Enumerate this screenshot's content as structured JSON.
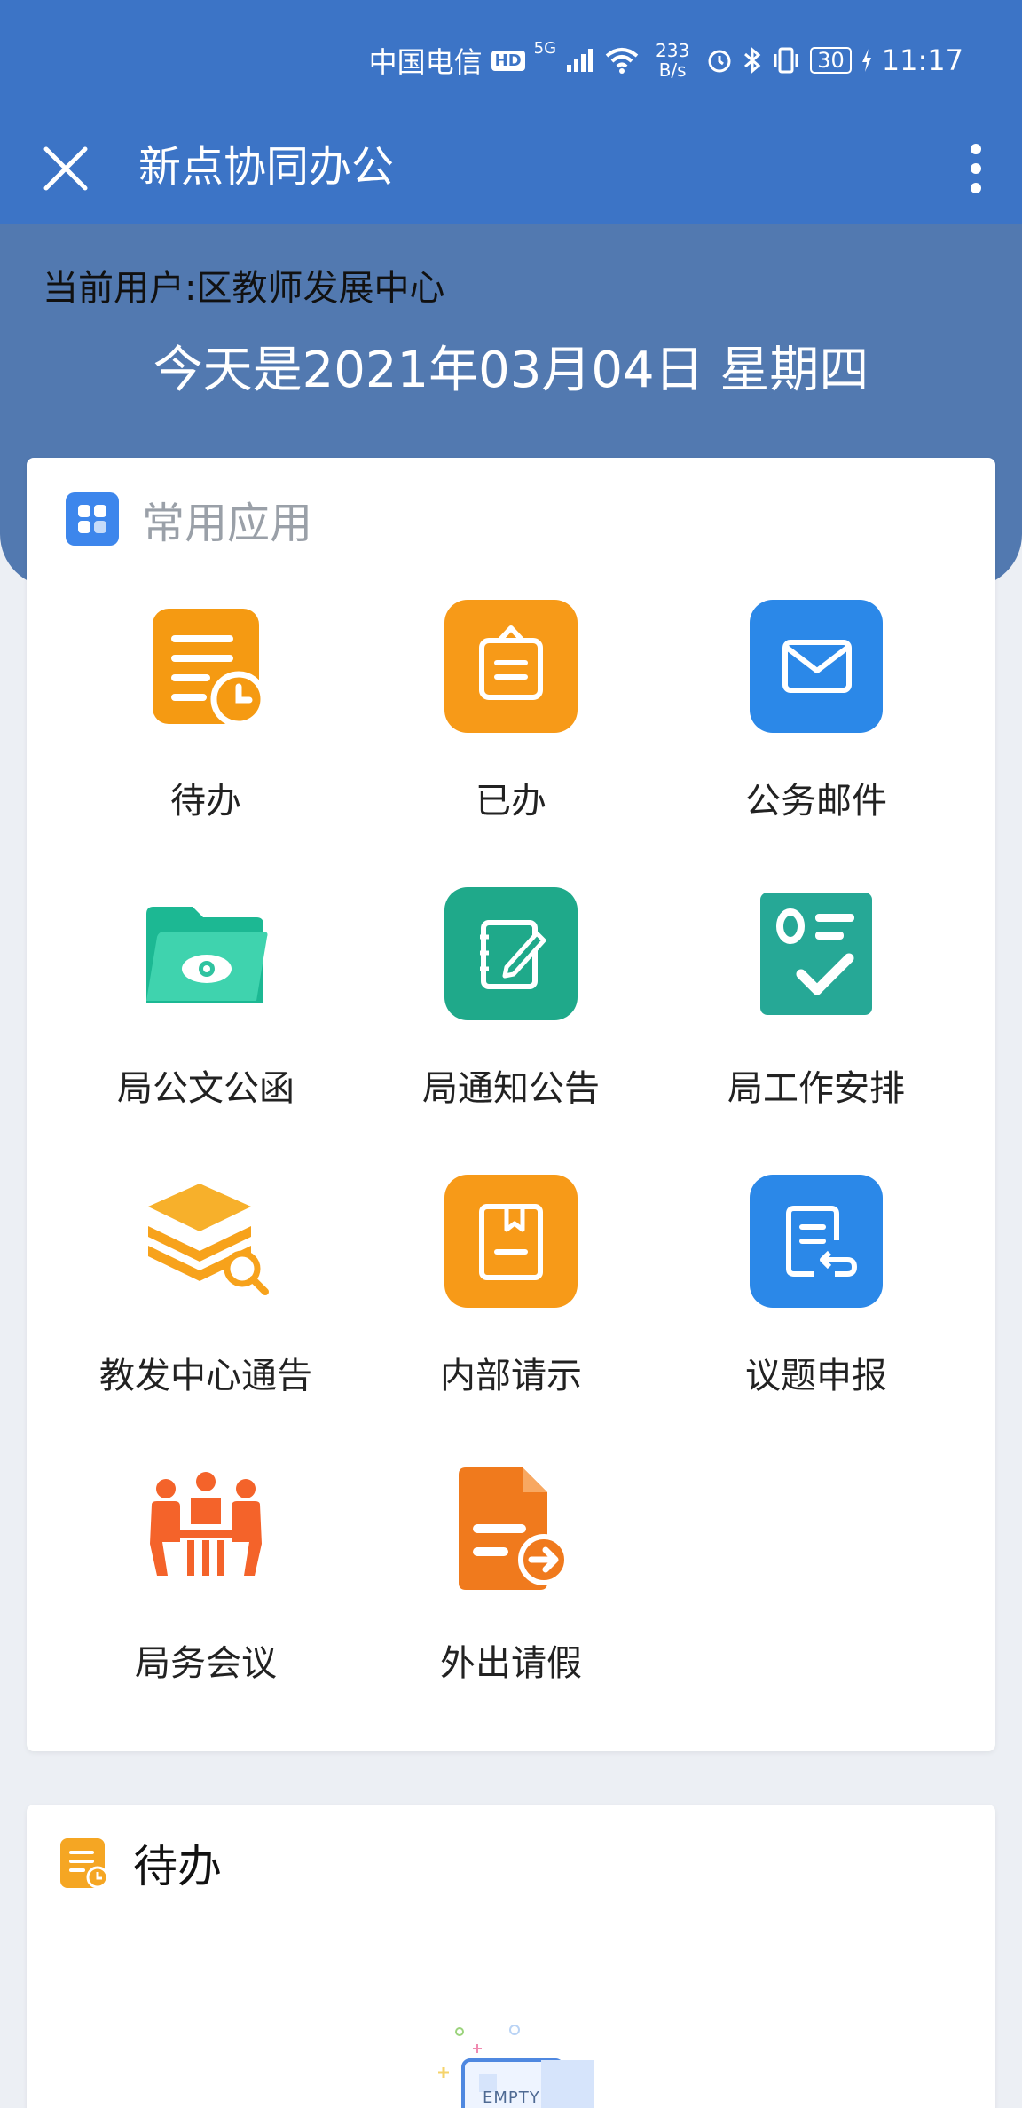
{
  "status": {
    "carrier": "中国电信",
    "hd": "HD",
    "net": "5G",
    "speed_value": "233",
    "speed_unit": "B/s",
    "battery": "30",
    "time": "11:17"
  },
  "appbar": {
    "title": "新点协同办公",
    "close_icon": "close-icon",
    "more_icon": "more-vertical-icon"
  },
  "header": {
    "user": "当前用户:区教师发展中心",
    "date": "今天是2021年03月04日 星期四"
  },
  "apps_section": {
    "title": "常用应用",
    "items": [
      {
        "label": "待办",
        "icon": "todo-list-clock-icon",
        "color": "#f59a12"
      },
      {
        "label": "已办",
        "icon": "clipboard-done-icon",
        "color": "#f59a12"
      },
      {
        "label": "公务邮件",
        "icon": "mail-icon",
        "color": "#2b88e8"
      },
      {
        "label": "局公文公函",
        "icon": "folder-eye-icon",
        "color": "#27c2a0"
      },
      {
        "label": "局通知公告",
        "icon": "note-edit-icon",
        "color": "#1fa98a"
      },
      {
        "label": "局工作安排",
        "icon": "task-check-icon",
        "color": "#26a896"
      },
      {
        "label": "教发中心通告",
        "icon": "stack-search-icon",
        "color": "#f7a21b"
      },
      {
        "label": "内部请示",
        "icon": "bookmark-doc-icon",
        "color": "#f59a12"
      },
      {
        "label": "议题申报",
        "icon": "doc-return-icon",
        "color": "#2b88e8"
      },
      {
        "label": "局务会议",
        "icon": "meeting-people-icon",
        "color": "#f4632a"
      },
      {
        "label": "外出请假",
        "icon": "doc-arrow-out-icon",
        "color": "#f07a1d"
      }
    ]
  },
  "todo_section": {
    "title": "待办",
    "empty_text": "EMPTY"
  }
}
